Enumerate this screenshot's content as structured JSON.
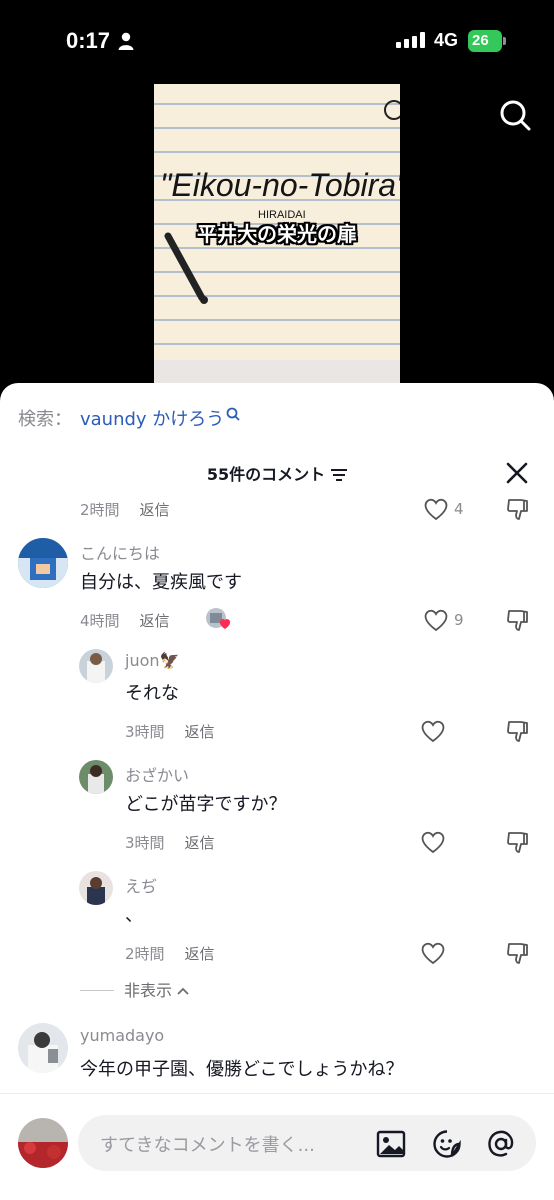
{
  "status_bar": {
    "time": "0:17",
    "network": "4G",
    "battery": "26"
  },
  "video": {
    "caption": "平井大の栄光の扉",
    "note_title": "\"Eikou-no-Tobira\"",
    "note_sub": "HIRAIDAI"
  },
  "sheet": {
    "search_prefix": "検索：",
    "search_query": "vaundy かけろう",
    "header_title": "55件のコメント",
    "input_placeholder": "すてきなコメントを書く..."
  },
  "comments": [
    {
      "time": "2時間",
      "reply": "返信",
      "likes": "4"
    },
    {
      "username": "こんにちは",
      "text": "自分は、夏疾風です",
      "time": "4時間",
      "reply": "返信",
      "likes": "9"
    },
    {
      "username": "juon🦅",
      "text": "それな",
      "time": "3時間",
      "reply": "返信"
    },
    {
      "username": "おざかい",
      "text": "どこが苗字ですか？",
      "time": "3時間",
      "reply": "返信"
    },
    {
      "username": "えぢ",
      "text": "、",
      "time": "2時間",
      "reply": "返信"
    },
    {
      "username": "yumadayo",
      "text": "今年の甲子園、優勝どこでしょうかね？"
    }
  ],
  "hide_label": "非表示",
  "icons": [
    "person-icon",
    "signal-icon",
    "search-icon",
    "filter-icon",
    "close-icon",
    "heart-icon",
    "thumb-down-icon",
    "image-icon",
    "emoji-icon",
    "mention-icon"
  ],
  "colors": {
    "link_blue": "#2b5db8",
    "battery_green": "#34c759",
    "text_gray": "#8a8b91"
  }
}
